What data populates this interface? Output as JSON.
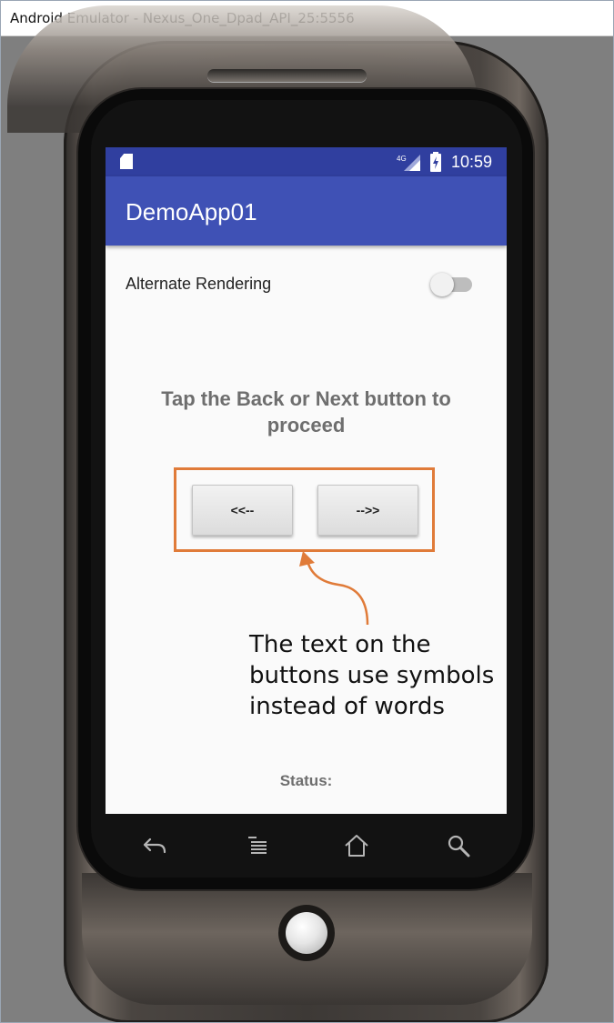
{
  "window": {
    "title": "Android Emulator - Nexus_One_Dpad_API_25:5556"
  },
  "statusbar": {
    "network_label": "4G",
    "time": "10:59",
    "icons": [
      "sd-card-icon",
      "signal-icon",
      "battery-charging-icon"
    ]
  },
  "appbar": {
    "title": "DemoApp01"
  },
  "settings": {
    "alternate_rendering_label": "Alternate Rendering",
    "alternate_rendering_on": false
  },
  "main": {
    "instruction": "Tap the Back or Next button to proceed",
    "back_button_label": "<<--",
    "next_button_label": "-->>",
    "status_label": "Status:"
  },
  "navbar": {
    "icons": [
      "back-icon",
      "menu-icon",
      "home-icon",
      "search-icon"
    ]
  },
  "annotation": {
    "callout_text": "The text on the buttons use symbols instead of words",
    "accent_color": "#e07b39"
  },
  "colors": {
    "statusbar": "#303f9f",
    "appbar": "#3f51b5",
    "background": "#fafafa"
  }
}
